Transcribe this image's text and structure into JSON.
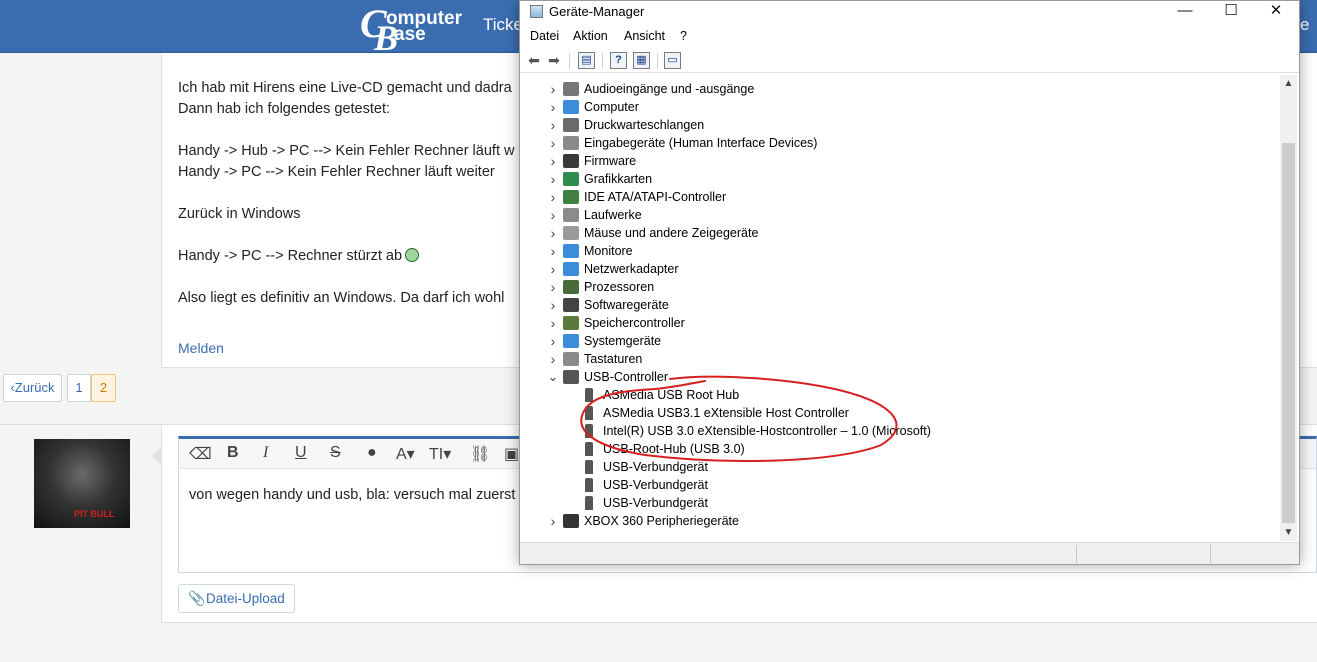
{
  "forum": {
    "header": {
      "logo_line1": "omputer",
      "logo_line2": "ase",
      "logo_c": "C",
      "logo_b": "B",
      "nav_ticker": "Ticke",
      "nav_right": "e"
    },
    "post": {
      "lines": [
        "Ich hab mit Hirens eine Live-CD gemacht und dadra",
        "Dann hab ich folgendes getestet:",
        "Handy -> Hub -> PC --> Kein Fehler Rechner läuft w",
        "Handy -> PC --> Kein Fehler Rechner läuft weiter",
        "Zurück in Windows",
        "Handy -> PC --> Rechner stürzt ab",
        "Also liegt es definitiv an Windows. Da darf ich wohl"
      ],
      "report_link": "Melden"
    },
    "pagination": {
      "back": "Zurück",
      "pages": [
        "1",
        "2"
      ],
      "current_page": "2"
    },
    "reply": {
      "editor_text": "von wegen handy und usb, bla: versuch mal zuerst",
      "upload_button": "Datei-Upload",
      "toolbar": [
        "eraser-icon",
        "B",
        "I",
        "U",
        "S",
        "drop-icon",
        "A",
        "TI",
        "link-icon",
        "image-icon"
      ],
      "avatar_tag": "PIT BULL"
    }
  },
  "device_manager": {
    "title": "Geräte-Manager",
    "window_controls": {
      "minimize": "—",
      "maximize": "☐",
      "close": "✕"
    },
    "menu": [
      "Datei",
      "Aktion",
      "Ansicht",
      "?"
    ],
    "toolbar_icons": [
      "back-arrow-icon",
      "forward-arrow-icon",
      "properties-icon",
      "help-icon",
      "view-icon",
      "monitor-icon"
    ],
    "tree": [
      {
        "label": "Audioeingänge und -ausgänge",
        "icon": "speaker-icon",
        "color": "#777777",
        "state": "collapsed"
      },
      {
        "label": "Computer",
        "icon": "computer-icon",
        "color": "#3c8dd8",
        "state": "collapsed"
      },
      {
        "label": "Druckwarteschlangen",
        "icon": "printer-icon",
        "color": "#6a6a6a",
        "state": "collapsed"
      },
      {
        "label": "Eingabegeräte (Human Interface Devices)",
        "icon": "hid-icon",
        "color": "#8a8a8a",
        "state": "collapsed"
      },
      {
        "label": "Firmware",
        "icon": "firmware-icon",
        "color": "#3a3a3a",
        "state": "collapsed"
      },
      {
        "label": "Grafikkarten",
        "icon": "display-adapter-icon",
        "color": "#2f8c4f",
        "state": "collapsed"
      },
      {
        "label": "IDE ATA/ATAPI-Controller",
        "icon": "ide-icon",
        "color": "#3f7f3f",
        "state": "collapsed"
      },
      {
        "label": "Laufwerke",
        "icon": "drive-icon",
        "color": "#8b8b8b",
        "state": "collapsed"
      },
      {
        "label": "Mäuse und andere Zeigegeräte",
        "icon": "mouse-icon",
        "color": "#9a9a9a",
        "state": "collapsed"
      },
      {
        "label": "Monitore",
        "icon": "monitor-icon",
        "color": "#3c8dd8",
        "state": "collapsed"
      },
      {
        "label": "Netzwerkadapter",
        "icon": "network-icon",
        "color": "#3c8dd8",
        "state": "collapsed"
      },
      {
        "label": "Prozessoren",
        "icon": "processor-icon",
        "color": "#4a6a3a",
        "state": "collapsed"
      },
      {
        "label": "Softwaregeräte",
        "icon": "software-device-icon",
        "color": "#444444",
        "state": "collapsed"
      },
      {
        "label": "Speichercontroller",
        "icon": "storage-controller-icon",
        "color": "#5a7a3a",
        "state": "collapsed"
      },
      {
        "label": "Systemgeräte",
        "icon": "system-devices-icon",
        "color": "#3c8dd8",
        "state": "collapsed"
      },
      {
        "label": "Tastaturen",
        "icon": "keyboard-icon",
        "color": "#8a8a8a",
        "state": "collapsed"
      },
      {
        "label": "USB-Controller",
        "icon": "usb-icon",
        "color": "#555555",
        "state": "expanded"
      },
      {
        "label": "ASMedia USB Root Hub",
        "icon": "usb-icon",
        "color": "#555555",
        "state": "child"
      },
      {
        "label": "ASMedia USB3.1 eXtensible Host Controller",
        "icon": "usb-icon",
        "color": "#555555",
        "state": "child"
      },
      {
        "label": "Intel(R) USB 3.0 eXtensible-Hostcontroller – 1.0 (Microsoft)",
        "icon": "usb-icon",
        "color": "#555555",
        "state": "child"
      },
      {
        "label": "USB-Root-Hub (USB 3.0)",
        "icon": "usb-icon",
        "color": "#555555",
        "state": "child"
      },
      {
        "label": "USB-Verbundgerät",
        "icon": "usb-icon",
        "color": "#555555",
        "state": "child"
      },
      {
        "label": "USB-Verbundgerät",
        "icon": "usb-icon",
        "color": "#555555",
        "state": "child"
      },
      {
        "label": "USB-Verbundgerät",
        "icon": "usb-icon",
        "color": "#555555",
        "state": "child"
      },
      {
        "label": "XBOX 360 Peripheriegeräte",
        "icon": "gamepad-icon",
        "color": "#333333",
        "state": "collapsed"
      }
    ],
    "annotation_color": "#d62020"
  },
  "colors": {
    "forum_header": "#3a6db0",
    "link": "#3a6db0",
    "active_page": "#d27a00"
  }
}
